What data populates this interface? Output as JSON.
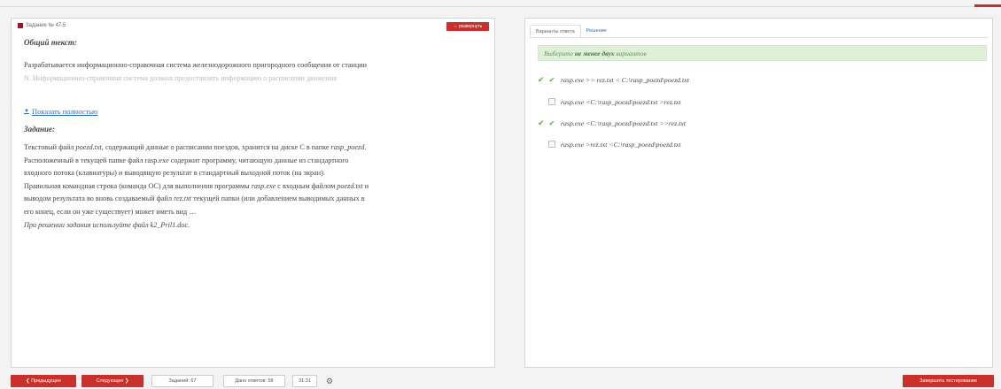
{
  "task": {
    "header": "Задание № 47.5",
    "expand_label": "развернуть",
    "general_title": "Общий текст:",
    "general_line1": "Разрабатывается информационно-справочная система железнодорожного пригородного сообщения от станции",
    "general_line2": "N. Информационно-справочная система должна предоставлять информацию о расписании движения",
    "show_more": "Показать полностью",
    "task_title": "Задание:",
    "task_lines": [
      "Текстовый файл poezd.txt, содержащий данные о расписании поездов, хранится на диске С в папке rasp_poezd.",
      "Расположенный в текущей папке файл rasp.exe содержит программу, читающую данные из стандартного",
      "входного потока (клавиатуры) и выводящую результат в стандартный выходной поток (на экран).",
      "Правильная командная строка (команда ОС) для выполнения программы rasp.exe с входным файлом poezd.txt и",
      "выводом результата во вновь создаваемый файл rez.txt текущей папки (или добавлением выводимых данных в",
      "его конец, если он уже существует) может иметь вид …"
    ],
    "task_note": "При решении задания используйте файл k2_Pril1.doc."
  },
  "answers": {
    "tab_variants": "Варианты ответа",
    "tab_solution": "Решение",
    "hint_prefix": "Выберите ",
    "hint_bold": "не менее двух",
    "hint_suffix": " вариантов",
    "options": [
      {
        "text": "rasp.exe >> rez.txt  < C:\\rasp_poezd\\poezd.txt",
        "checked": true
      },
      {
        "text": "rasp.exe <C:\\rasp_poezd\\poezd.txt  >rez.txt",
        "checked": false
      },
      {
        "text": "rasp.exe <C:\\rasp_poezd\\poezd.txt  >>rez.txt",
        "checked": true
      },
      {
        "text": "rasp.exe >rez.txt <C:\\rasp_poezd\\poezd.txt",
        "checked": false
      }
    ]
  },
  "footer": {
    "prev": "❮ Предыдущее",
    "next": "Следующее ❯",
    "task_num": "Заданий: 67",
    "answered": "Дано ответов: 58",
    "timer": "31:31",
    "finish": "Завершить тестирование"
  },
  "colors": {
    "accent_red": "#c9302c",
    "check_green": "#5fae3c"
  }
}
